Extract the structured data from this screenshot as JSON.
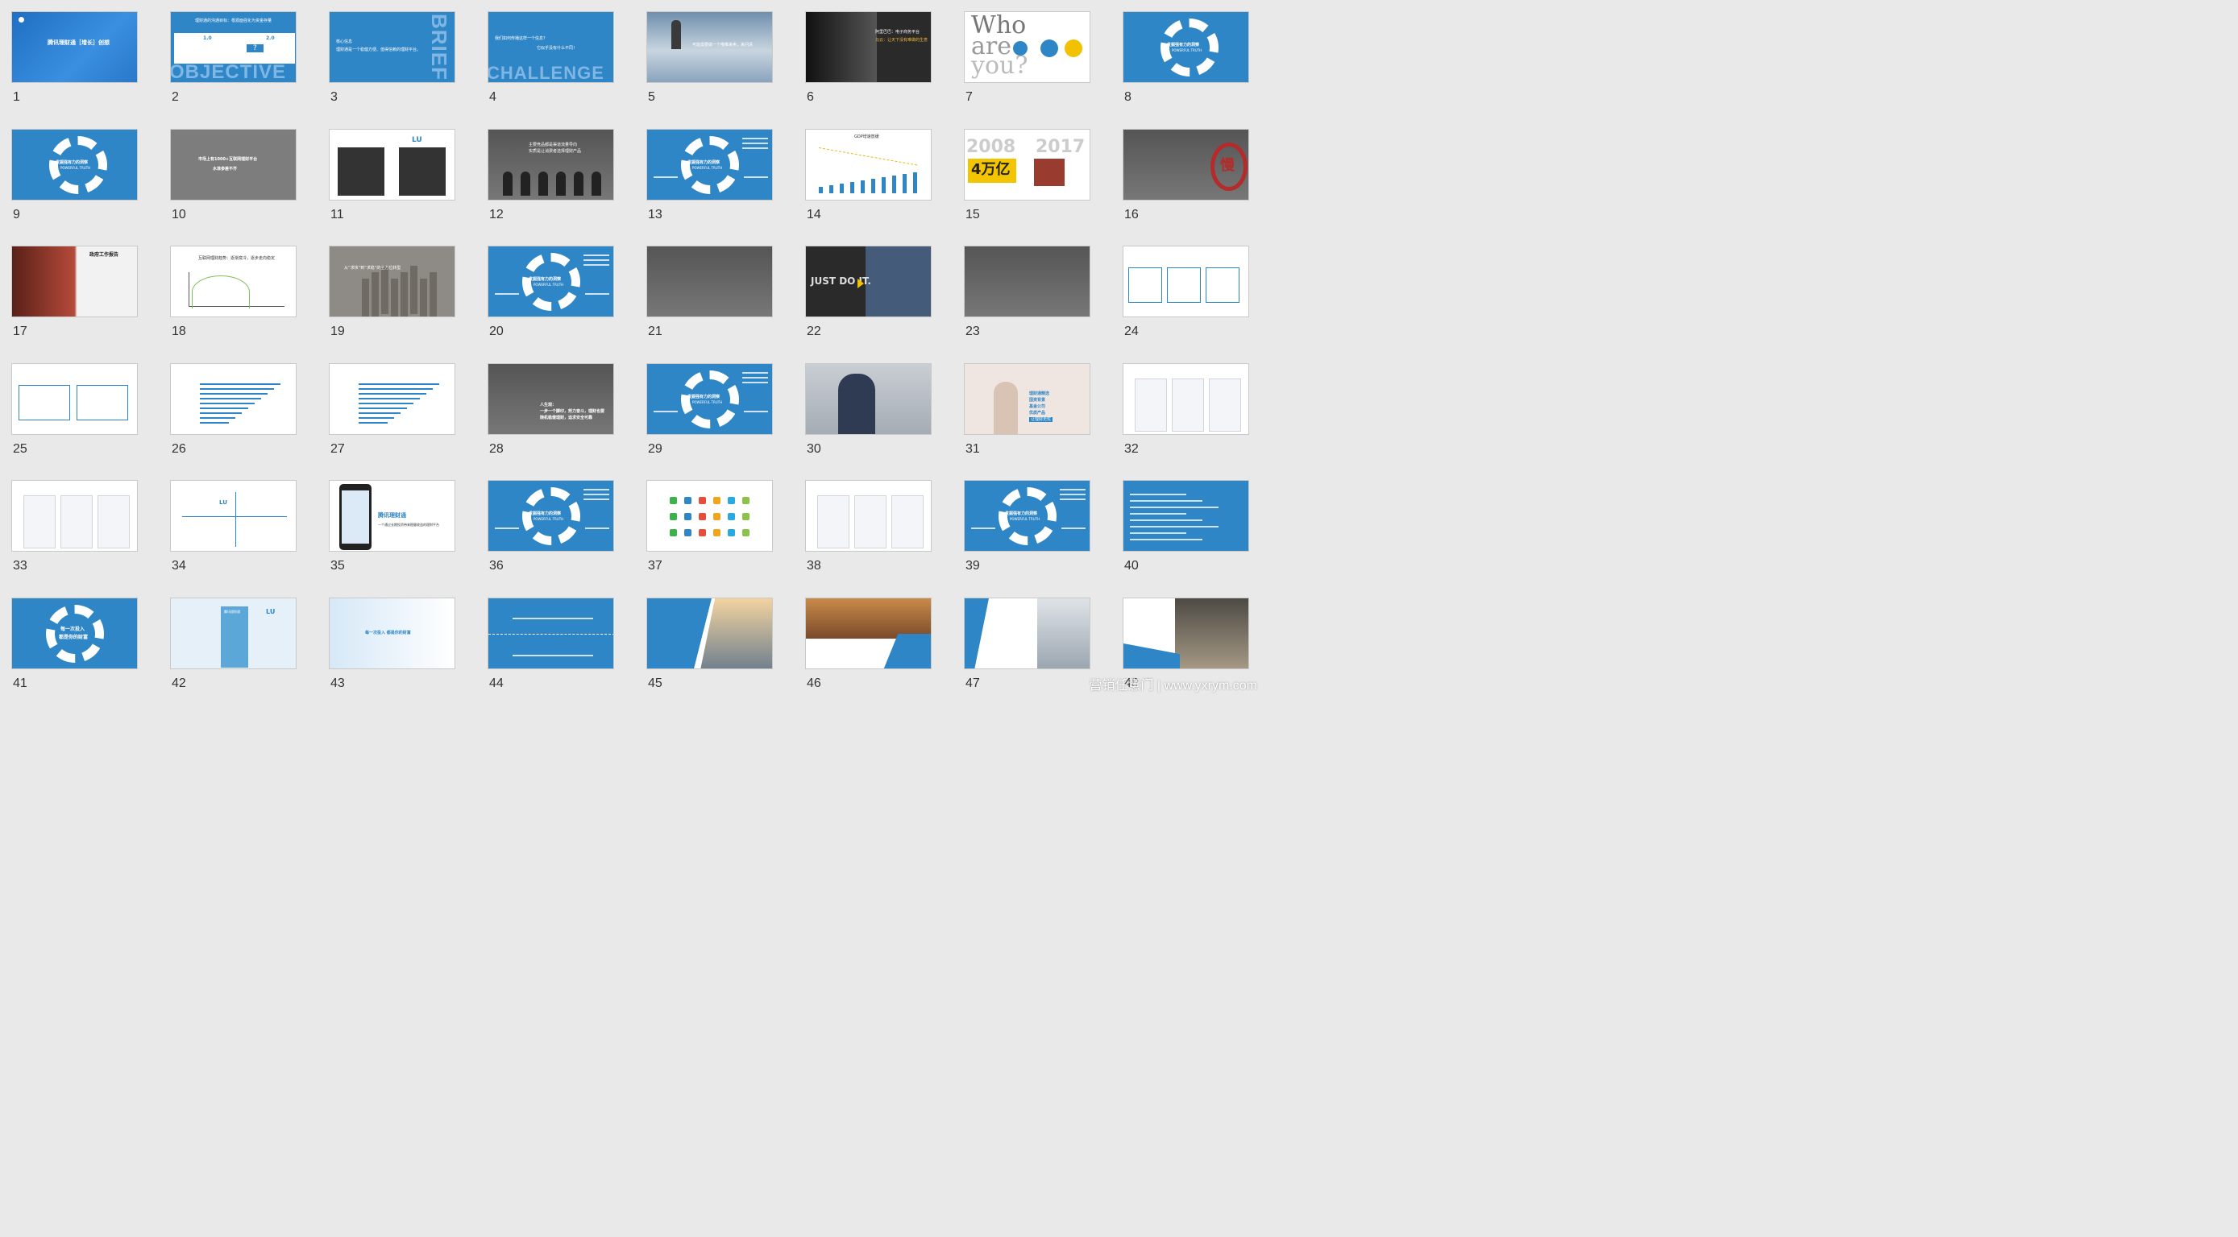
{
  "watermark": "营销任意门 | www.yxrym.com",
  "slides": [
    {
      "n": "1",
      "lines": [
        "腾讯理财通［增长］创想"
      ]
    },
    {
      "n": "2",
      "lines": [
        "理财通的沟通目标：根源面强化为资金存量",
        "1.0",
        "2.0",
        "?",
        "OBJECTIVE"
      ]
    },
    {
      "n": "3",
      "lines": [
        "核心信息",
        "理财通是一个稳健方便、值得信赖的理财平台。",
        "BRIEF"
      ]
    },
    {
      "n": "4",
      "lines": [
        "我们如何传播这样一个信息？",
        "它似乎没有什么不同！",
        "CHALLENGE"
      ]
    },
    {
      "n": "5",
      "lines": [
        "可能需要做一个哦推来卖，来问清"
      ]
    },
    {
      "n": "6",
      "lines": [
        "阿里巴巴：电子商务平台",
        "马云：让天下没有难做的生意"
      ]
    },
    {
      "n": "7",
      "lines": [
        "Who",
        "are",
        "you?"
      ]
    },
    {
      "n": "8",
      "lines": [
        "发掘强有力的洞察",
        "POWERFUL TRUTH"
      ]
    },
    {
      "n": "9",
      "lines": [
        "发掘强有力的洞察",
        "POWERFUL TRUTH"
      ]
    },
    {
      "n": "10",
      "lines": [
        "市场上有1000+互联网理财平台",
        "水准参差不齐"
      ]
    },
    {
      "n": "11",
      "lines": [
        "LU"
      ]
    },
    {
      "n": "12",
      "lines": [
        "主要竞品都是渠道流量导向",
        "实质是让消费者选择理财产品"
      ]
    },
    {
      "n": "13",
      "lines": [
        "发掘强有力的洞察",
        "POWERFUL TRUTH"
      ]
    },
    {
      "n": "14",
      "lines": [
        "GDP增速放缓"
      ]
    },
    {
      "n": "15",
      "lines": [
        "2008",
        "2017",
        "4万亿"
      ]
    },
    {
      "n": "16",
      "lines": [
        "慢"
      ]
    },
    {
      "n": "17",
      "lines": [
        "政府工作报告"
      ]
    },
    {
      "n": "18",
      "lines": [
        "互联网理财趋势：逐渐变冷，逐步走向稳定"
      ]
    },
    {
      "n": "19",
      "lines": [
        "从“求快”到“求稳”的全方位转型"
      ]
    },
    {
      "n": "20",
      "lines": [
        "发掘强有力的洞察",
        "POWERFUL TRUTH"
      ]
    },
    {
      "n": "21",
      "lines": []
    },
    {
      "n": "22",
      "lines": [
        "JUST DO IT."
      ]
    },
    {
      "n": "23",
      "lines": []
    },
    {
      "n": "24",
      "lines": []
    },
    {
      "n": "25",
      "lines": []
    },
    {
      "n": "26",
      "lines": []
    },
    {
      "n": "27",
      "lines": []
    },
    {
      "n": "28",
      "lines": [
        "人生观：",
        "一步一个脚印，努力奋斗，理财也要",
        "随机稳健理财，追求安全可靠"
      ]
    },
    {
      "n": "29",
      "lines": [
        "发掘强有力的洞察",
        "POWERFUL TRUTH"
      ]
    },
    {
      "n": "30",
      "lines": []
    },
    {
      "n": "31",
      "lines": [
        "理财通精选",
        "国资背景",
        "基金公司",
        "优质产品",
        "让理财无忧"
      ]
    },
    {
      "n": "32",
      "lines": []
    },
    {
      "n": "33",
      "lines": []
    },
    {
      "n": "34",
      "lines": [
        "LU"
      ]
    },
    {
      "n": "35",
      "lines": [
        "腾讯理财通",
        "一个通过长期投资带来稳健收益的理财平台"
      ]
    },
    {
      "n": "36",
      "lines": [
        "发掘强有力的洞察",
        "POWERFUL TRUTH"
      ]
    },
    {
      "n": "37",
      "lines": []
    },
    {
      "n": "38",
      "lines": []
    },
    {
      "n": "39",
      "lines": [
        "发掘强有力的洞察",
        "POWERFUL TRUTH"
      ]
    },
    {
      "n": "40",
      "lines": []
    },
    {
      "n": "41",
      "lines": [
        "每一次投入",
        "都是你的财富"
      ]
    },
    {
      "n": "42",
      "lines": [
        "LU",
        "腾讯理财通"
      ]
    },
    {
      "n": "43",
      "lines": [
        "每一次投入 都是你的财富"
      ]
    },
    {
      "n": "44",
      "lines": []
    },
    {
      "n": "45",
      "lines": []
    },
    {
      "n": "46",
      "lines": []
    },
    {
      "n": "47",
      "lines": []
    },
    {
      "n": "48",
      "lines": []
    }
  ]
}
